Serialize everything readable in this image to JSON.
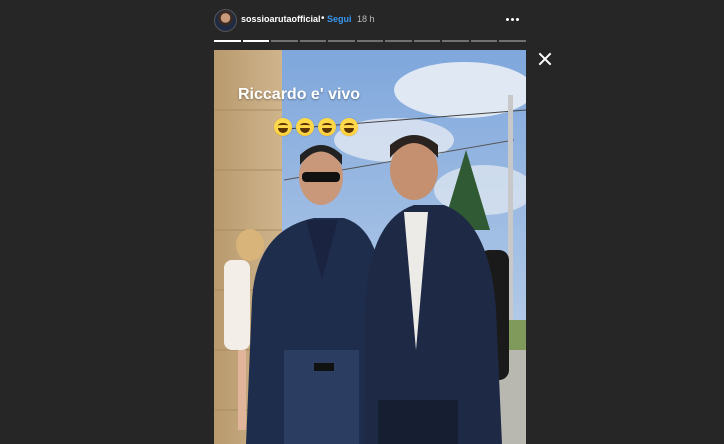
{
  "header": {
    "username": "sossioarutaofficial",
    "separator": "•",
    "follow_label": "Segui",
    "time": "18 h"
  },
  "progress": {
    "total_segments": 11,
    "current_segment": 2
  },
  "story": {
    "caption": "Riccardo e' vivo",
    "emojis": [
      "grinning-squinting-face",
      "grinning-squinting-face",
      "grinning-squinting-face",
      "grinning-squinting-face"
    ]
  },
  "icons": {
    "more": "more-options-icon",
    "close": "close-icon"
  },
  "colors": {
    "background": "#262626",
    "follow": "#3897f0",
    "text": "#ffffff"
  }
}
